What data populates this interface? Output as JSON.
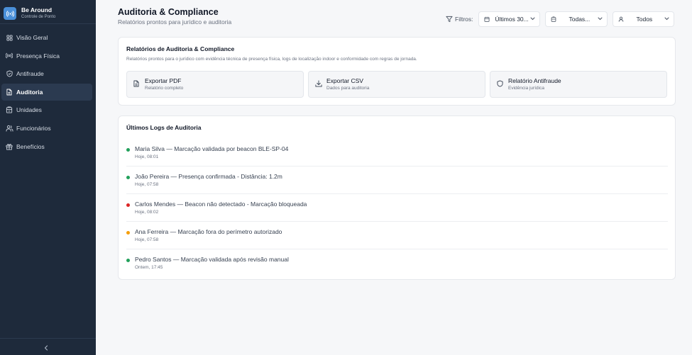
{
  "app": {
    "name": "Be Around",
    "subtitle": "Controle de Ponto"
  },
  "sidebar": {
    "items": [
      {
        "label": "Visão Geral",
        "icon": "grid-icon"
      },
      {
        "label": "Presença Física",
        "icon": "radio-icon"
      },
      {
        "label": "Antifraude",
        "icon": "shield-check-icon"
      },
      {
        "label": "Auditoria",
        "icon": "file-text-icon",
        "active": true
      },
      {
        "label": "Unidades",
        "icon": "building-icon"
      },
      {
        "label": "Funcionários",
        "icon": "users-icon"
      },
      {
        "label": "Benefícios",
        "icon": "gift-icon"
      }
    ],
    "collapse_icon": "chevron-left-icon"
  },
  "header": {
    "title": "Auditoria & Compliance",
    "subtitle": "Relatórios prontos para jurídico e auditoria"
  },
  "filters": {
    "label": "Filtros:",
    "period": "Últimos 30...",
    "unit": "Todas...",
    "employee": "Todos"
  },
  "reports": {
    "title": "Relatórios de Auditoria & Compliance",
    "description": "Relatórios prontos para o jurídico com evidência técnica de presença física, logs de localização indoor e conformidade com regras de jornada.",
    "buttons": [
      {
        "title": "Exportar PDF",
        "subtitle": "Relatório completo",
        "icon": "file-icon"
      },
      {
        "title": "Exportar CSV",
        "subtitle": "Dados para auditoria",
        "icon": "download-icon"
      },
      {
        "title": "Relatório Antifraude",
        "subtitle": "Evidência jurídica",
        "icon": "shield-icon"
      }
    ]
  },
  "logs": {
    "title": "Últimos Logs de Auditoria",
    "items": [
      {
        "text": "Maria Silva — Marcação validada por beacon BLE-SP-04",
        "time": "Hoje, 08:01",
        "status_color": "#22a05b"
      },
      {
        "text": "João Pereira — Presença confirmada - Distância: 1.2m",
        "time": "Hoje, 07:58",
        "status_color": "#22a05b"
      },
      {
        "text": "Carlos Mendes — Beacon não detectado - Marcação bloqueada",
        "time": "Hoje, 08:02",
        "status_color": "#dc2626"
      },
      {
        "text": "Ana Ferreira — Marcação fora do perímetro autorizado",
        "time": "Hoje, 07:58",
        "status_color": "#f59e0b"
      },
      {
        "text": "Pedro Santos — Marcação validada após revisão manual",
        "time": "Ontem, 17:45",
        "status_color": "#22a05b"
      }
    ]
  },
  "colors": {
    "sidebar_bg": "#1e2a3b",
    "accent": "#4a90d9",
    "success": "#22a05b",
    "danger": "#dc2626",
    "warning": "#f59e0b"
  }
}
